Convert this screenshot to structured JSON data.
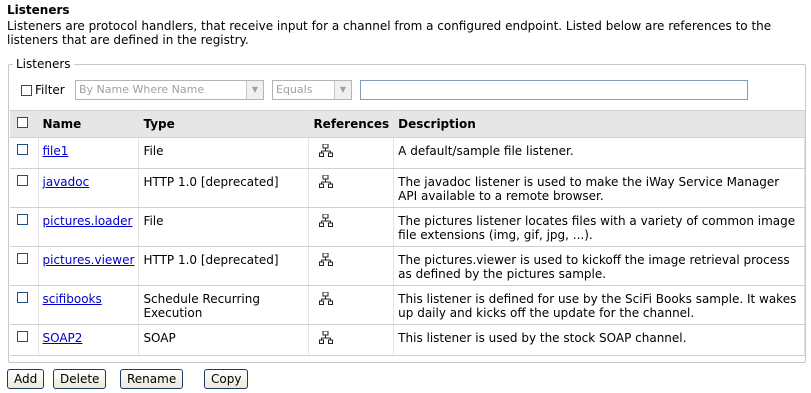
{
  "page": {
    "title": "Listeners",
    "intro": "Listeners are protocol handlers, that receive input for a channel from a configured endpoint. Listed below are references to the listeners that are defined in the registry."
  },
  "group": {
    "legend": "Listeners"
  },
  "filter": {
    "label": "Filter",
    "field_select": "By Name Where Name",
    "operator_select": "Equals",
    "value": ""
  },
  "table": {
    "headers": {
      "name": "Name",
      "type": "Type",
      "references": "References",
      "description": "Description"
    },
    "rows": [
      {
        "name": "file1",
        "type": "File",
        "description": "A default/sample file listener."
      },
      {
        "name": "javadoc",
        "type": "HTTP 1.0 [deprecated]",
        "description": "The javadoc listener is used to make the iWay Service Manager API available to a remote browser."
      },
      {
        "name": "pictures.loader",
        "type": "File",
        "description": "The pictures listener locates files with a variety of common image file extensions (img, gif, jpg, ...)."
      },
      {
        "name": "pictures.viewer",
        "type": "HTTP 1.0 [deprecated]",
        "description": "The pictures.viewer is used to kickoff the image retrieval process as defined by the pictures sample."
      },
      {
        "name": "scifibooks",
        "type": "Schedule Recurring Execution",
        "description": "This listener is defined for use by the SciFi Books sample. It wakes up daily and kicks off the update for the channel."
      },
      {
        "name": "SOAP2",
        "type": "SOAP",
        "description": "This listener is used by the stock SOAP channel."
      }
    ]
  },
  "buttons": {
    "add": "Add",
    "delete": "Delete",
    "rename": "Rename",
    "copy": "Copy"
  },
  "icons": {
    "references": "references-tree-icon"
  }
}
